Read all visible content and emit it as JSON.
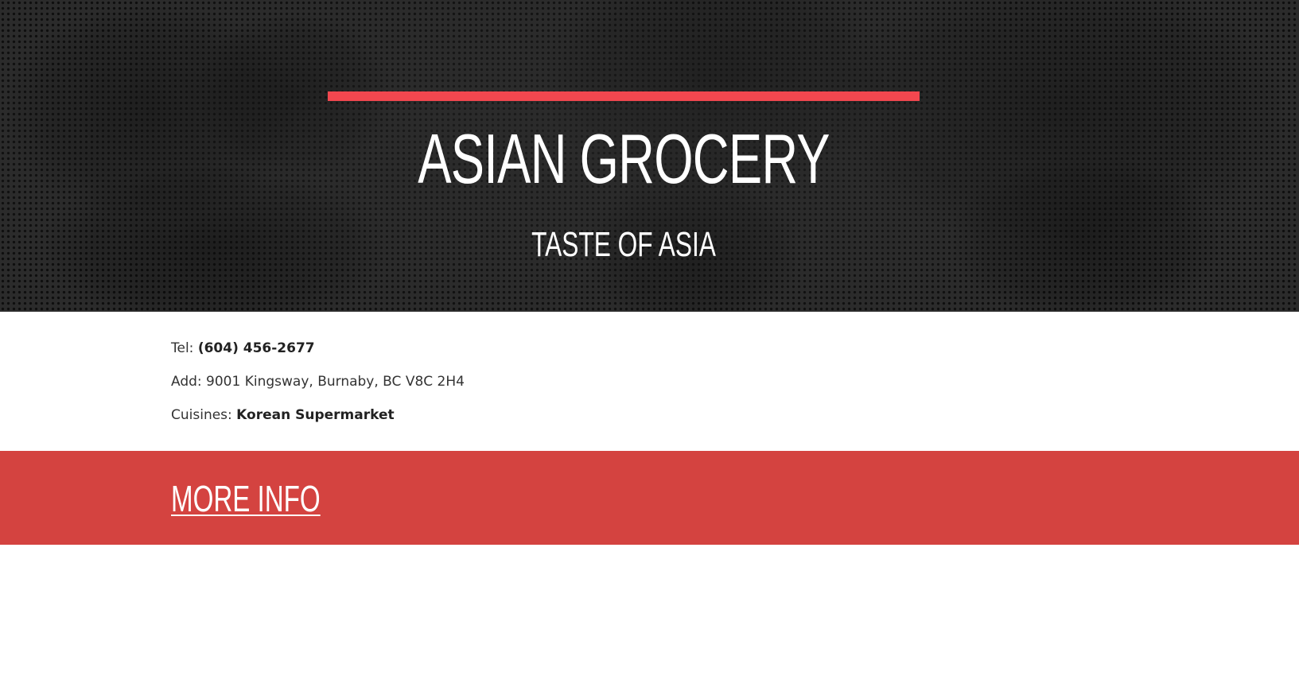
{
  "hero": {
    "title": "ASIAN GROCERY",
    "subtitle": "TASTE OF ASIA",
    "accent_color": "#f2474f",
    "background_color": "#2b2b2b"
  },
  "details": {
    "tel_label": "Tel:",
    "tel_value": "(604) 456-2677",
    "address_label": "Add:",
    "address_value": "9001 Kingsway, Burnaby, BC V8C 2H4",
    "cuisines_label": "Cuisines:",
    "cuisines_value": "Korean Supermarket"
  },
  "cta": {
    "label": "MORE INFO",
    "band_color": "#d44340"
  }
}
